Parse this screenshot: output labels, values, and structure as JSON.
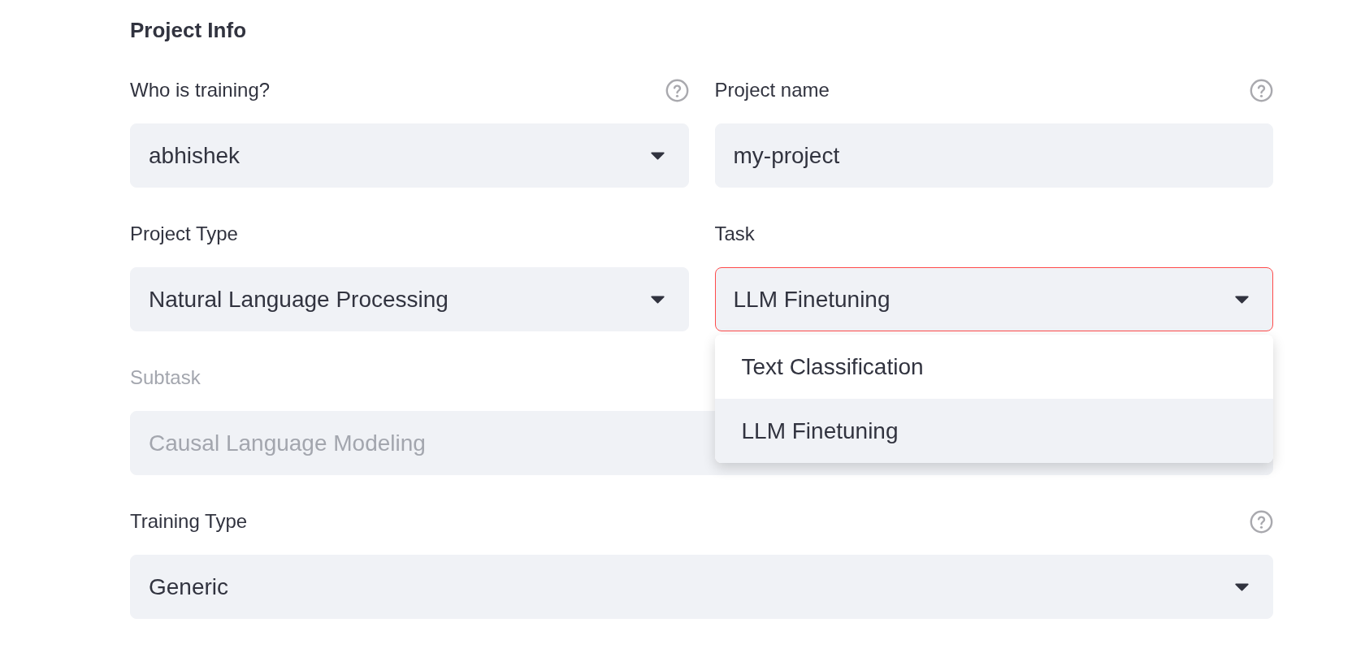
{
  "section": {
    "title": "Project Info"
  },
  "rows": [
    {
      "fields": [
        {
          "kind": "select",
          "label": "Who is training?",
          "value": "abhishek",
          "help": true,
          "disabled": false,
          "focused": false
        },
        {
          "kind": "text",
          "label": "Project name",
          "value": "my-project",
          "help": true,
          "disabled": false,
          "focused": false
        }
      ]
    },
    {
      "fields": [
        {
          "kind": "select",
          "label": "Project Type",
          "value": "Natural Language Processing",
          "help": false,
          "disabled": false,
          "focused": false
        },
        {
          "kind": "select",
          "label": "Task",
          "value": "LLM Finetuning",
          "help": false,
          "disabled": false,
          "focused": true,
          "open": true,
          "options": [
            {
              "label": "Text Classification",
              "selected": false
            },
            {
              "label": "LLM Finetuning",
              "selected": true
            }
          ]
        }
      ]
    },
    {
      "fields": [
        {
          "kind": "text",
          "label": "Subtask",
          "value": "Causal Language Modeling",
          "help": false,
          "disabled": true,
          "focused": false
        }
      ]
    },
    {
      "fields": [
        {
          "kind": "select",
          "label": "Training Type",
          "value": "Generic",
          "help": true,
          "disabled": false,
          "focused": false
        }
      ]
    }
  ]
}
